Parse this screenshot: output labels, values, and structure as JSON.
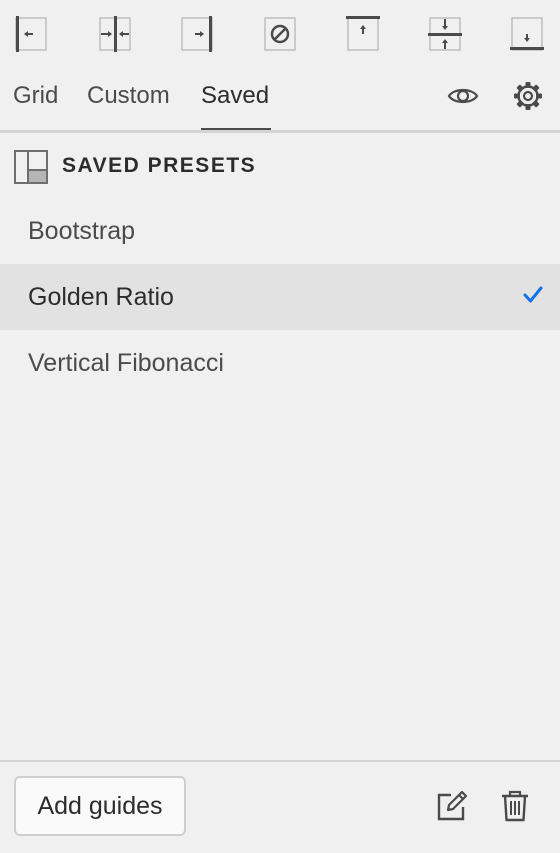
{
  "toolbar": {
    "tools": [
      {
        "icon": "align-left-icon"
      },
      {
        "icon": "align-horizontal-center-icon"
      },
      {
        "icon": "align-right-icon"
      },
      {
        "icon": "clear-guides-icon"
      },
      {
        "icon": "align-top-icon"
      },
      {
        "icon": "align-vertical-center-icon"
      },
      {
        "icon": "align-bottom-icon"
      }
    ]
  },
  "tabs": {
    "items": [
      {
        "label": "Grid"
      },
      {
        "label": "Custom"
      },
      {
        "label": "Saved"
      }
    ],
    "active": "Saved",
    "icons": [
      "eye-icon",
      "gear-icon"
    ]
  },
  "section": {
    "title": "SAVED PRESETS",
    "icon": "layout-preset-icon"
  },
  "presets": [
    {
      "label": "Bootstrap",
      "selected": false
    },
    {
      "label": "Golden Ratio",
      "selected": true
    },
    {
      "label": "Vertical Fibonacci",
      "selected": false
    }
  ],
  "footer": {
    "add_label": "Add guides",
    "icons": [
      "edit-icon",
      "trash-icon"
    ]
  },
  "colors": {
    "background": "#f0f0f0",
    "selected_row": "#e2e2e2",
    "accent_check": "#1473e6",
    "icon_gray": "#4b4b4b"
  }
}
